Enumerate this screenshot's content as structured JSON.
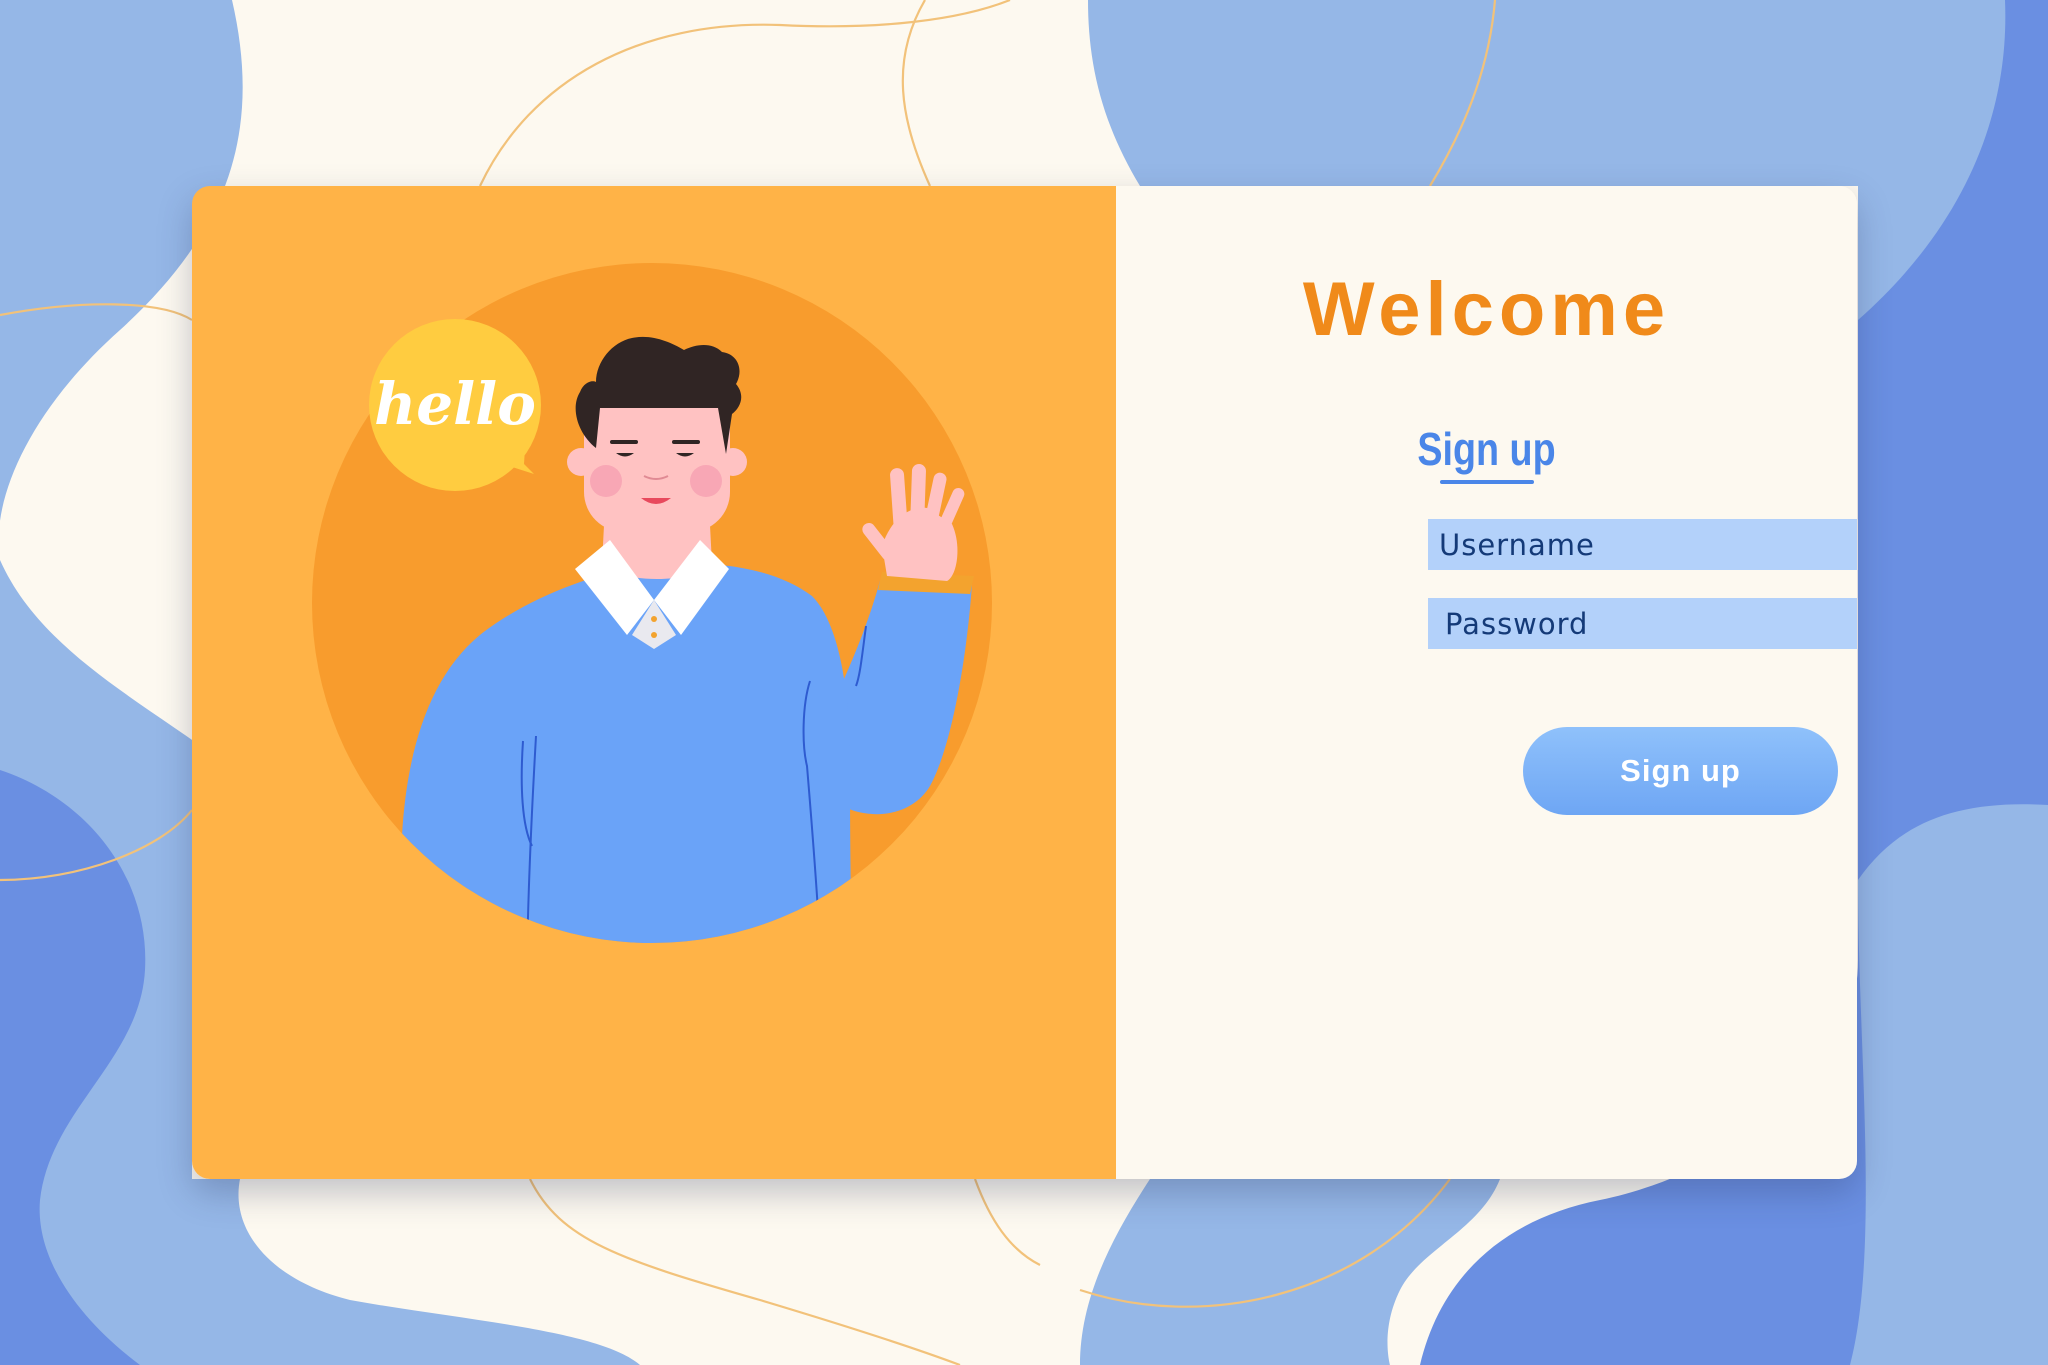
{
  "bubble": {
    "text": "hello"
  },
  "form": {
    "heading": "Welcome",
    "tab_label": "Sign up",
    "username_placeholder": "Username",
    "password_placeholder": "Password",
    "submit_label": "Sign up"
  },
  "colors": {
    "background": "#fdf9f0",
    "blob_light": "#95b7e7",
    "blob_dark": "#6a8fe2",
    "panel_orange": "#ffb347",
    "circle_orange": "#f89c2d",
    "accent_orange": "#f08a1a",
    "accent_blue": "#4a86e8",
    "input_fill": "#b3d1fa"
  }
}
